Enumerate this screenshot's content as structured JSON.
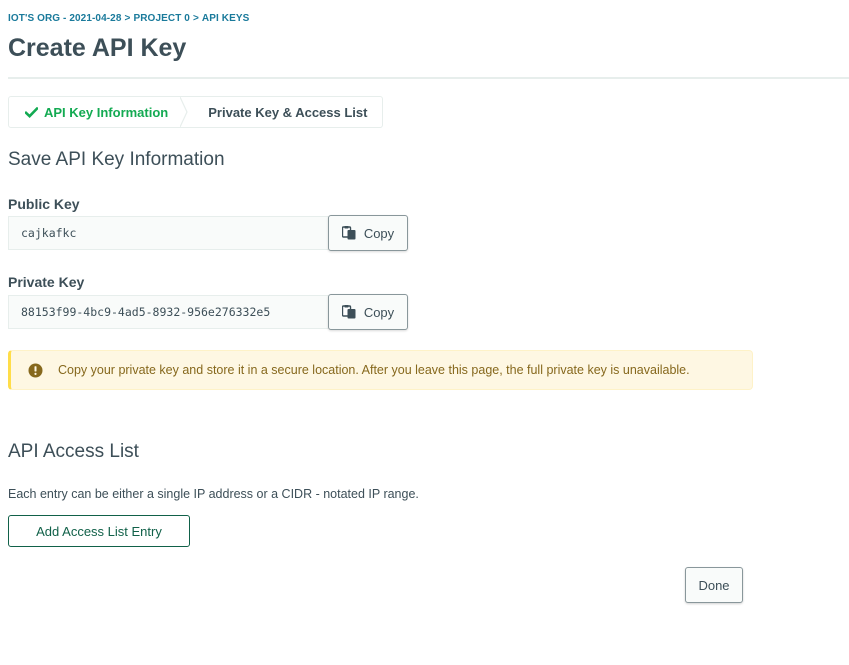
{
  "breadcrumb": {
    "org": "IOT'S ORG - 2021-04-28",
    "sep1": ">",
    "project": "PROJECT 0",
    "sep2": ">",
    "current": "API KEYS"
  },
  "page_title": "Create API Key",
  "wizard": {
    "steps": [
      {
        "label": "API Key Information",
        "status": "complete",
        "icon": "checkmark-icon"
      },
      {
        "label": "Private Key & Access List",
        "status": "current"
      }
    ]
  },
  "save_section": {
    "title": "Save API Key Information",
    "public_key": {
      "label": "Public Key",
      "value": "cajkafkc",
      "copy_label": "Copy",
      "copy_icon": "copy-icon"
    },
    "private_key": {
      "label": "Private Key",
      "value": "88153f99-4bc9-4ad5-8932-956e276332e5",
      "copy_label": "Copy",
      "copy_icon": "copy-icon"
    },
    "warning": {
      "icon": "exclamation-circle-icon",
      "text": "Copy your private key and store it in a secure location. After you leave this page, the full private key is unavailable."
    }
  },
  "access_list": {
    "title": "API Access List",
    "description": "Each entry can be either a single IP address or a CIDR - notated IP range.",
    "add_button_label": "Add Access List Entry"
  },
  "footer": {
    "done_label": "Done"
  },
  "colors": {
    "brand_green": "#13aa52",
    "dark_green": "#116149",
    "link_blue": "#1a7a9b",
    "text": "#3d4f58",
    "warning_bg": "#fef7e3",
    "warning_accent": "#ffdd49"
  }
}
